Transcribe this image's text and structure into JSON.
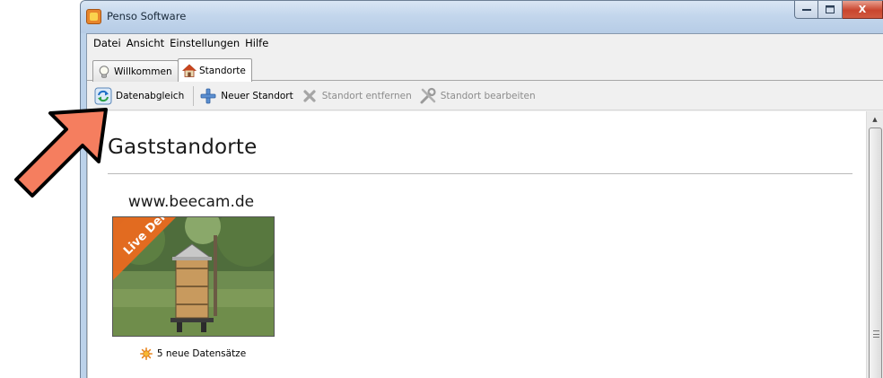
{
  "window": {
    "title": "Penso Software",
    "buttons": {
      "minimize": "–",
      "maximize": "□",
      "close": "X"
    }
  },
  "menu": [
    {
      "label": "Datei"
    },
    {
      "label": "Ansicht"
    },
    {
      "label": "Einstellungen"
    },
    {
      "label": "Hilfe"
    }
  ],
  "tabs": [
    {
      "label": "Willkommen",
      "icon": "lightbulb-icon",
      "active": false
    },
    {
      "label": "Standorte",
      "icon": "house-icon",
      "active": true
    }
  ],
  "toolbar": {
    "sync_label": "Datenabgleich",
    "new_label": "Neuer Standort",
    "remove_label": "Standort entfernen",
    "edit_label": "Standort bearbeiten"
  },
  "content": {
    "section_title": "Gaststandorte",
    "card": {
      "title": "www.beecam.de",
      "badge": "Live Demo",
      "status": "5 neue Datensätze"
    }
  },
  "colors": {
    "badge_orange": "#e96a1f",
    "arrow_fill": "#f57e5f",
    "window_frame": "#bcd2ea"
  }
}
